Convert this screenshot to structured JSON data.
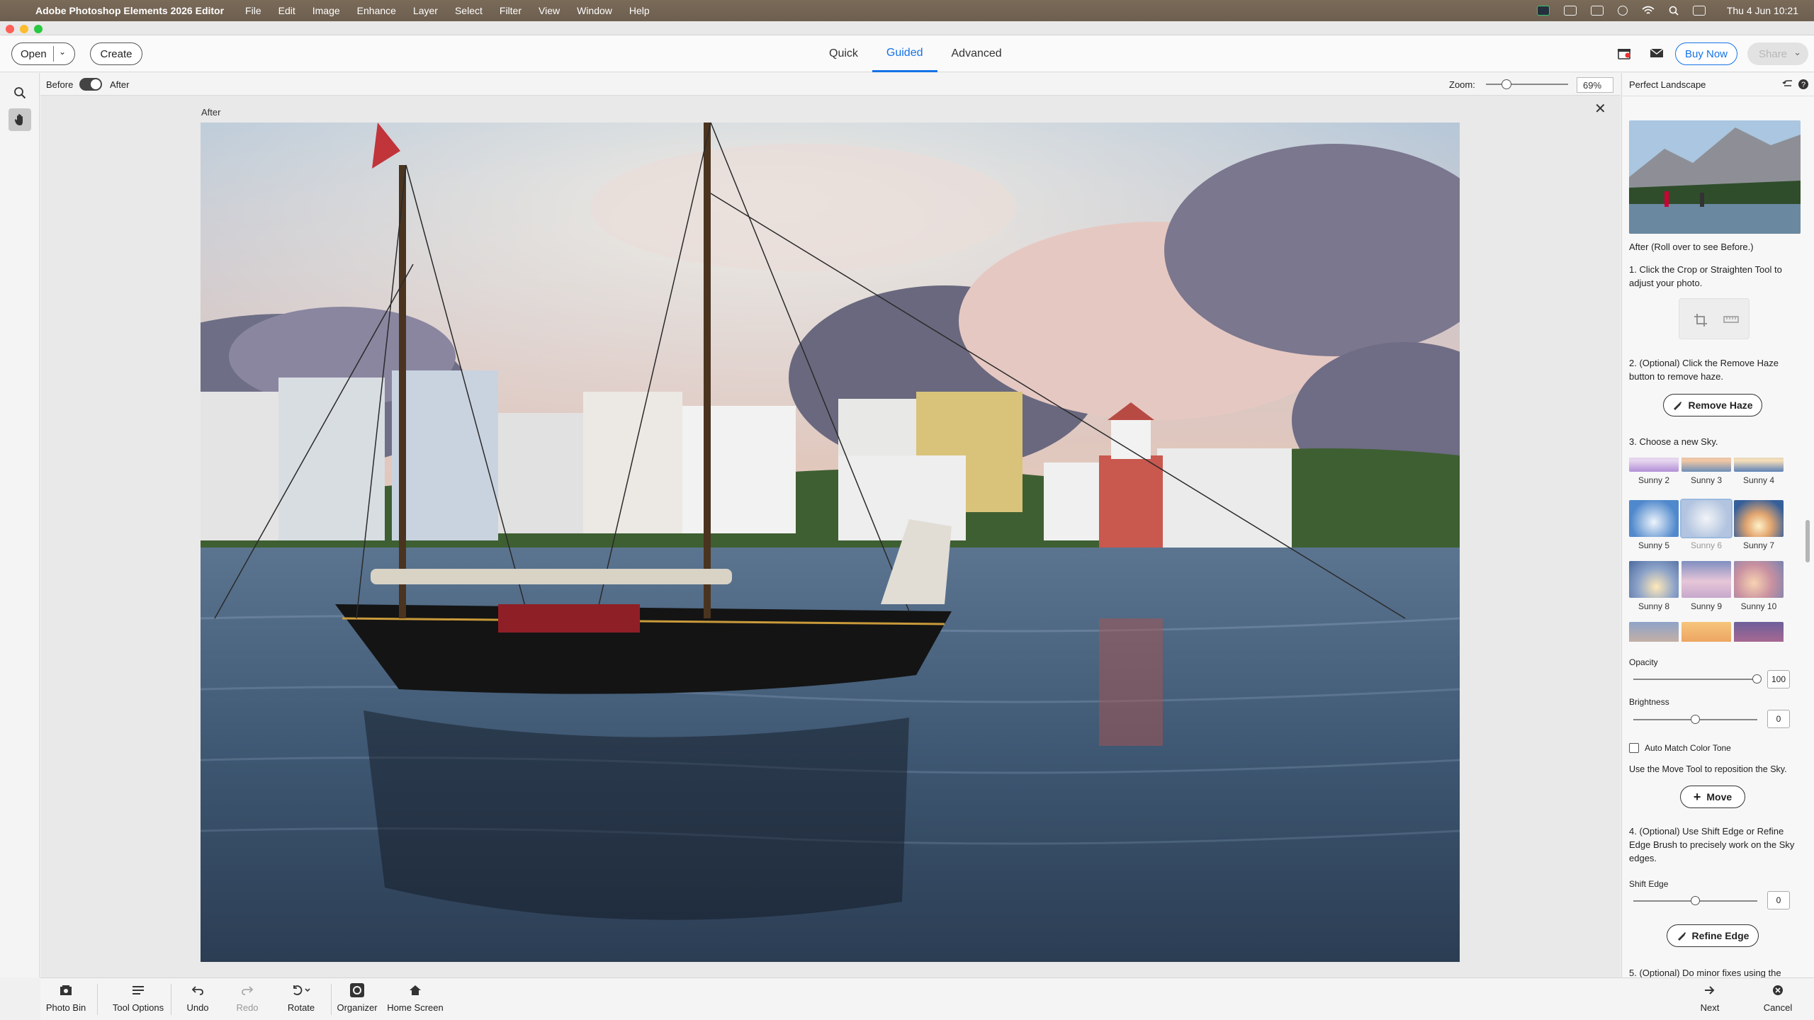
{
  "menubar": {
    "app_name": "Adobe Photoshop Elements 2026 Editor",
    "menus": [
      "File",
      "Edit",
      "Image",
      "Enhance",
      "Layer",
      "Select",
      "Filter",
      "View",
      "Window",
      "Help"
    ],
    "clock": "Thu 4 Jun  10:21"
  },
  "appbar": {
    "open_label": "Open",
    "create_label": "Create",
    "tabs": [
      "Quick",
      "Guided",
      "Advanced"
    ],
    "active_tab": "Guided",
    "buy_now_label": "Buy Now",
    "share_label": "Share",
    "accent_color": "#1473e6"
  },
  "options_bar": {
    "before_label": "Before",
    "after_label": "After",
    "zoom_label": "Zoom:",
    "zoom_value": "69%",
    "zoom_fraction": 0.15
  },
  "canvas": {
    "view_label": "After"
  },
  "panel": {
    "title": "Perfect Landscape",
    "thumb_caption": "After (Roll over to see Before.)",
    "step1": "1. Click the Crop or Straighten Tool to adjust your photo.",
    "step2": "2. (Optional) Click the Remove Haze button to remove haze.",
    "remove_haze_label": "Remove Haze",
    "step3": "3. Choose a new Sky.",
    "skies": [
      {
        "label": "Sunny 2"
      },
      {
        "label": "Sunny 3"
      },
      {
        "label": "Sunny 4"
      },
      {
        "label": "Sunny 5"
      },
      {
        "label": "Sunny 6",
        "selected": true
      },
      {
        "label": "Sunny 7"
      },
      {
        "label": "Sunny 8"
      },
      {
        "label": "Sunny 9"
      },
      {
        "label": "Sunny 10"
      }
    ],
    "opacity_label": "Opacity",
    "opacity_value": "100",
    "brightness_label": "Brightness",
    "brightness_value": "0",
    "auto_match_label": "Auto Match Color Tone",
    "auto_match_checked": false,
    "move_hint": "Use the Move Tool to reposition the Sky.",
    "move_label": "Move",
    "step4": "4. (Optional) Use Shift Edge or Refine Edge Brush to precisely work on the Sky edges.",
    "shift_edge_label": "Shift Edge",
    "shift_edge_value": "0",
    "refine_edge_label": "Refine Edge",
    "step5": "5. (Optional) Do minor fixes using the"
  },
  "bottombar": {
    "photo_bin": "Photo Bin",
    "tool_options": "Tool Options",
    "undo": "Undo",
    "redo": "Redo",
    "rotate": "Rotate",
    "organizer": "Organizer",
    "home_screen": "Home Screen",
    "next": "Next",
    "cancel": "Cancel"
  }
}
